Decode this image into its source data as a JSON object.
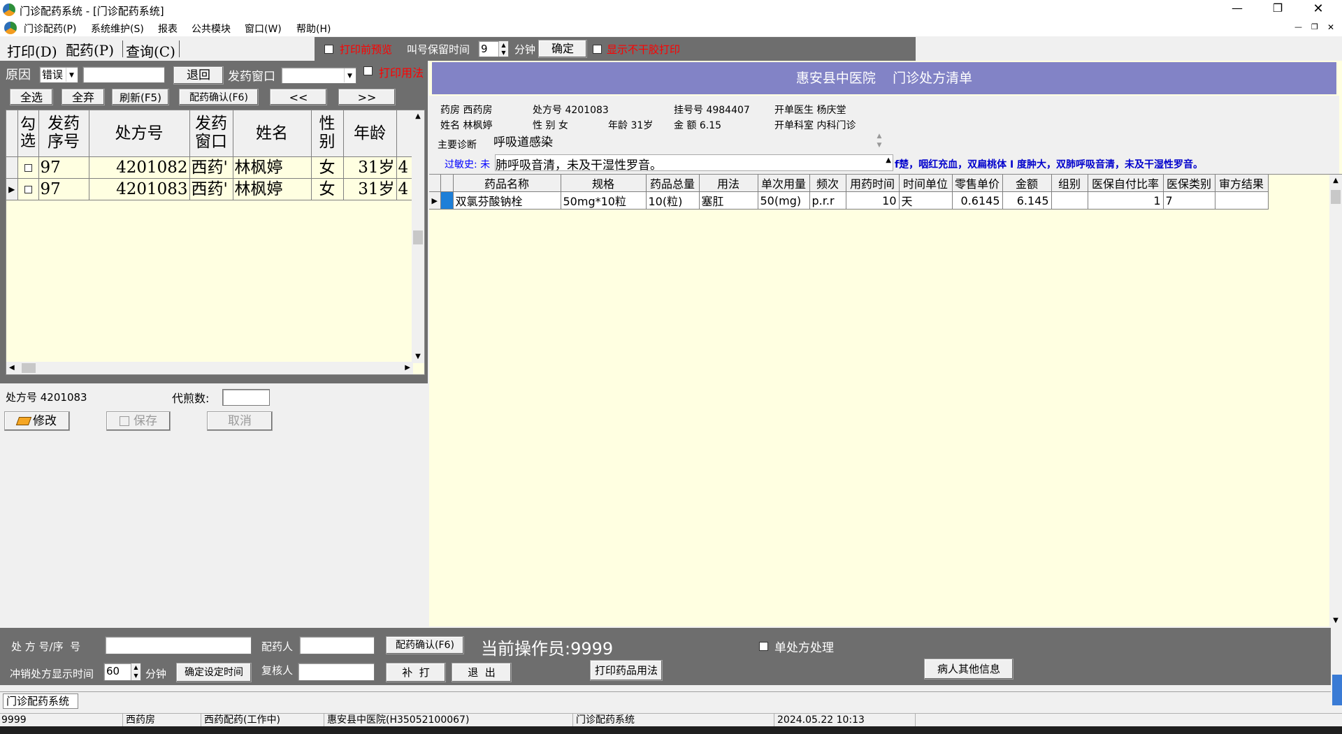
{
  "window": {
    "title": "门诊配药系统 - [门诊配药系统]",
    "controls": [
      "—",
      "❐",
      "✕"
    ]
  },
  "menubar": {
    "items": [
      "门诊配药(P)",
      "系统维护(S)",
      "报表",
      "公共模块",
      "窗口(W)",
      "帮助(H)"
    ]
  },
  "tabs": [
    "打印(D)",
    "配药(P)",
    "查询(C)"
  ],
  "topbar": {
    "print_preview_label": "打印前预览",
    "call_keep_label": "叫号保留时间",
    "call_keep_value": "9",
    "minute_label": "分钟",
    "confirm_label": "确定",
    "show_no_dry_label": "显示不干胶打印"
  },
  "left_panel": {
    "reason_label": "原因",
    "reason_value": "错误",
    "return_label": "退回",
    "dispense_window_label": "发药窗口",
    "print_usage_label": "打印用法",
    "buttons": [
      "全选",
      "全弃",
      "刷新(F5)",
      "配药确认(F6)",
      "<<",
      ">>"
    ],
    "table": {
      "headers": [
        "勾选",
        "发药序号",
        "处方号",
        "发药窗口",
        "姓名",
        "性别",
        "年龄"
      ],
      "rows": [
        {
          "check": "",
          "seq": "97",
          "rx": "4201082",
          "window": "西药'",
          "name": "林枫婷",
          "sex": "女",
          "age": "31岁",
          "extra": "4"
        },
        {
          "check": "",
          "seq": "97",
          "rx": "4201083",
          "window": "西药'",
          "name": "林枫婷",
          "sex": "女",
          "age": "31岁",
          "extra": "4"
        }
      ]
    },
    "rx_no_label": "处方号 4201083",
    "decoction_label": "代煎数:",
    "modify_label": "修改",
    "save_label": "保存",
    "cancel_label": "取消"
  },
  "prescription": {
    "header_title": "惠安县中医院    门诊处方清单",
    "pharmacy": "药房 西药房",
    "rx_no": "处方号 4201083",
    "reg_no": "挂号号 4984407",
    "doctor": "开单医生   杨庆堂",
    "name": "姓名 林枫婷",
    "sex": "性  别 女",
    "age": "年龄  31岁",
    "amount": "金  额 6.15",
    "dept": "开单科室   内科门诊",
    "diagnosis_label": "主要诊断",
    "diagnosis_value": "呼吸道感染",
    "allergy_label": "过敏史: 未",
    "exam_text": "肺呼吸音清，未及干湿性罗音。",
    "exam_text_right": "f楚，咽红充血，双扁桃体 I 度肿大，双肺呼吸音清，未及干湿性罗音。"
  },
  "drug_table": {
    "headers": [
      "药品名称",
      "规格",
      "药品总量",
      "用法",
      "单次用量",
      "频次",
      "用药时间",
      "时间单位",
      "零售单价",
      "金额",
      "组别",
      "医保自付比率",
      "医保类别",
      "审方结果"
    ],
    "rows": [
      {
        "name": "双氯芬酸钠栓",
        "spec": "50mg*10粒",
        "total": "10(粒)",
        "usage": "塞肛",
        "dose": "50(mg)",
        "freq": "p.r.r",
        "days": "10",
        "unit": "天",
        "price": "0.6145",
        "amount": "6.145",
        "group": "",
        "ratio": "1",
        "ins_type": "7",
        "review": ""
      }
    ]
  },
  "bottom": {
    "rx_seq_label": "处 方 号/序  号",
    "dispenser_label": "配药人",
    "confirm_label": "配药确认(F6)",
    "operator_label": "当前操作员:9999",
    "single_rx_label": "单处方处理",
    "writeoff_label": "冲销处方显示时间",
    "writeoff_value": "60",
    "minute_label": "分钟",
    "set_time_label": "确定设定时间",
    "reviewer_label": "复核人",
    "reprint_label": "补  打",
    "exit_label": "退  出",
    "print_usage_label": "打印药品用法",
    "patient_info_label": "病人其他信息"
  },
  "taskbar": {
    "tab": "门诊配药系统"
  },
  "statusbar": [
    "9999",
    "西药房",
    "西药配药(工作中)",
    "惠安县中医院(H35052100067)",
    "门诊配药系统",
    "2024.05.22 10:13"
  ],
  "colors": {
    "header_purple": "#8283c6",
    "grid_yellow": "#ffffe1",
    "dark_gray_bar": "#6e6e6e",
    "red_text": "#ff0000",
    "blue_text": "#0000ff"
  }
}
